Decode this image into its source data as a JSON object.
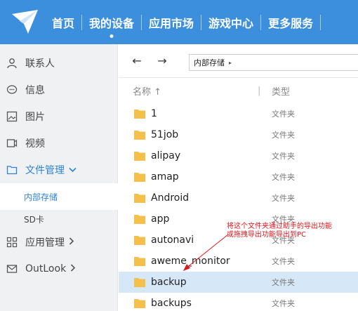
{
  "nav": {
    "items": [
      {
        "label": "首页"
      },
      {
        "label": "我的设备",
        "active": true
      },
      {
        "label": "应用市场"
      },
      {
        "label": "游戏中心"
      },
      {
        "label": "更多服务"
      }
    ]
  },
  "sidebar": {
    "items": [
      {
        "label": "联系人",
        "icon": "person-icon"
      },
      {
        "label": "信息",
        "icon": "message-icon"
      },
      {
        "label": "图片",
        "icon": "image-icon"
      },
      {
        "label": "视频",
        "icon": "video-icon"
      },
      {
        "label": "文件管理",
        "icon": "folder-icon",
        "expanded": true
      },
      {
        "label": "内部存储",
        "sub": true,
        "selected": true
      },
      {
        "label": "SD卡",
        "sub": true
      },
      {
        "label": "应用管理",
        "icon": "apps-icon"
      },
      {
        "label": "OutLook",
        "icon": "mail-icon"
      }
    ]
  },
  "toolbar": {
    "back": "←",
    "forward": "→",
    "path": "内部存储",
    "path_arrow": "▸"
  },
  "table": {
    "col_name": "名称 ↑",
    "col_sep": "|",
    "col_type": "类型",
    "rows": [
      {
        "name": "1",
        "type": "文件夹"
      },
      {
        "name": "51job",
        "type": "文件夹"
      },
      {
        "name": "alipay",
        "type": "文件夹"
      },
      {
        "name": "amap",
        "type": "文件夹"
      },
      {
        "name": "Android",
        "type": "文件夹"
      },
      {
        "name": "app",
        "type": "文件夹"
      },
      {
        "name": "autonavi",
        "type": "文件夹"
      },
      {
        "name": "aweme_monitor",
        "type": "文件夹"
      },
      {
        "name": "backup",
        "type": "文件夹",
        "selected": true
      },
      {
        "name": "backups",
        "type": "文件夹"
      }
    ]
  },
  "annotation": {
    "line1": "将这个文件夹通过助手的导出功能",
    "line2": "或拖拽导出功能导出到PC"
  },
  "colors": {
    "brand": "#3c8fdc",
    "accent": "#2d83d6",
    "selected_row": "#d6e8f7",
    "folder": "#f5c04a",
    "annotation": "#e0151b"
  }
}
